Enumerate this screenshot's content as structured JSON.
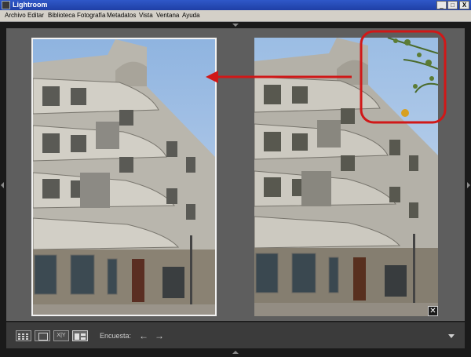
{
  "window": {
    "title": "Lightroom",
    "minimize": "_",
    "maximize": "□",
    "close": "X"
  },
  "menu": {
    "items": [
      "Archivo",
      "Editar",
      "Biblioteca",
      "Fotografía",
      "Metadatos",
      "Vista",
      "Ventana",
      "Ayuda"
    ]
  },
  "toolbar": {
    "survey_label": "Encuesta:",
    "compare_label": "X|Y"
  },
  "colors": {
    "titlebar": "#1f3fa6",
    "panel_bg": "#5e5e5e",
    "annotation_red": "#d01818"
  },
  "icons": {
    "grid_view": "grid-icon",
    "loupe_view": "loupe-icon",
    "compare_view": "compare-icon",
    "survey_view": "survey-icon",
    "prev": "arrow-left-icon",
    "next": "arrow-right-icon",
    "close_photo": "close-icon",
    "toolbar_menu": "chevron-down-icon"
  }
}
